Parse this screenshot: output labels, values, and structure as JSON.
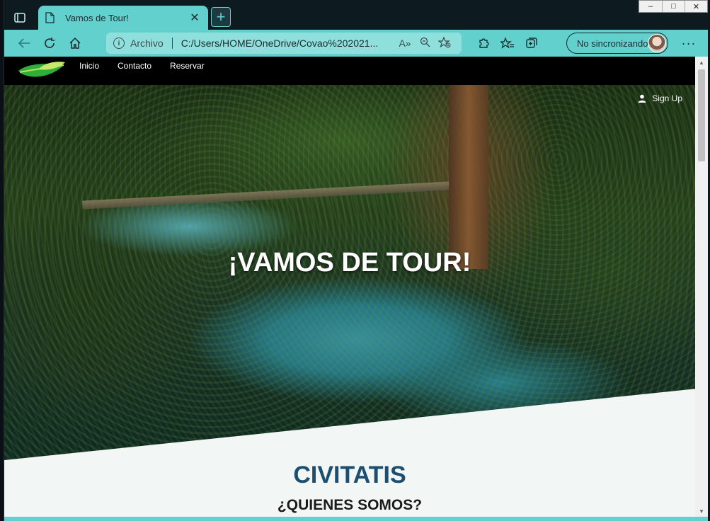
{
  "browser": {
    "tab_title": "Vamos de Tour!",
    "tab_close": "✕",
    "new_tab": "+",
    "address": {
      "scheme_label": "Archivo",
      "url": "C:/Users/HOME/OneDrive/Covao%202021..."
    },
    "profile_label": "No sincronizando",
    "more": "···",
    "window_controls": {
      "minimize": "–",
      "maximize": "□",
      "close": "✕"
    }
  },
  "site": {
    "nav": {
      "items": [
        "Inicio",
        "Contacto",
        "Reservar"
      ]
    },
    "signup_label": "Sign Up",
    "hero_title": "¡VAMOS DE TOUR!",
    "section_title": "CIVITATIS",
    "section_subtitle": "¿QUIENES SOMOS?"
  },
  "colors": {
    "browser_accent": "#62d0cd",
    "nav_bg": "#000000",
    "section_title": "#1b4e70",
    "logo_green": "#2fae3a"
  },
  "icons": [
    "tab-actions-icon",
    "document-icon",
    "back-arrow-icon",
    "refresh-icon",
    "home-icon",
    "info-icon",
    "read-aloud-icon",
    "zoom-out-icon",
    "add-favorite-icon",
    "extensions-icon",
    "favorites-icon",
    "collections-icon",
    "user-icon",
    "leaf-logo"
  ]
}
